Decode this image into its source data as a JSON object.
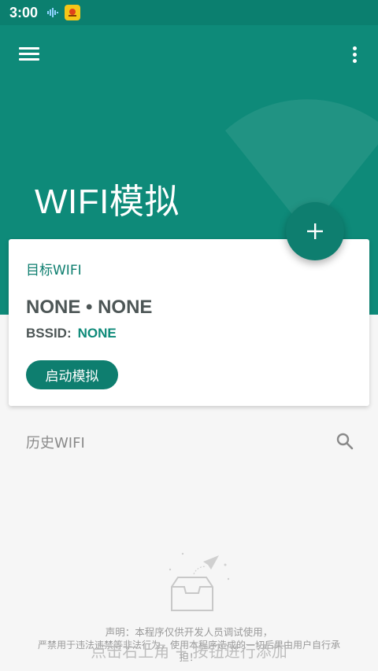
{
  "status_bar": {
    "time": "3:00",
    "icons": [
      "audio-wave-icon",
      "app-notification-icon"
    ]
  },
  "header": {
    "title": "WIFI模拟",
    "menu_icon": "hamburger-menu-icon",
    "more_icon": "more-vertical-icon",
    "background_color": "#0e8a79"
  },
  "fab": {
    "icon": "plus-icon"
  },
  "target_card": {
    "label": "目标WIFI",
    "ssid": "NONE • NONE",
    "bssid_label": "BSSID:",
    "bssid_value": "NONE",
    "start_button": "启动模拟"
  },
  "history": {
    "title": "历史WIFI",
    "search_icon": "search-icon"
  },
  "empty_state": {
    "icon": "empty-inbox-icon",
    "hint": "点击右上角 + 按钮进行添加"
  },
  "notice": {
    "line1": "声明：本程序仅供开发人员调试使用，",
    "line2": "严禁用于违法违禁等非法行为，使用本程序造成的一切后果由用户自行承",
    "line3": "担！"
  },
  "colors": {
    "primary": "#0e8a79",
    "primary_dark": "#0e7e6f",
    "status_bar": "#0b7f6f",
    "text_dark": "#4d5656",
    "background": "#f6f6f6"
  }
}
